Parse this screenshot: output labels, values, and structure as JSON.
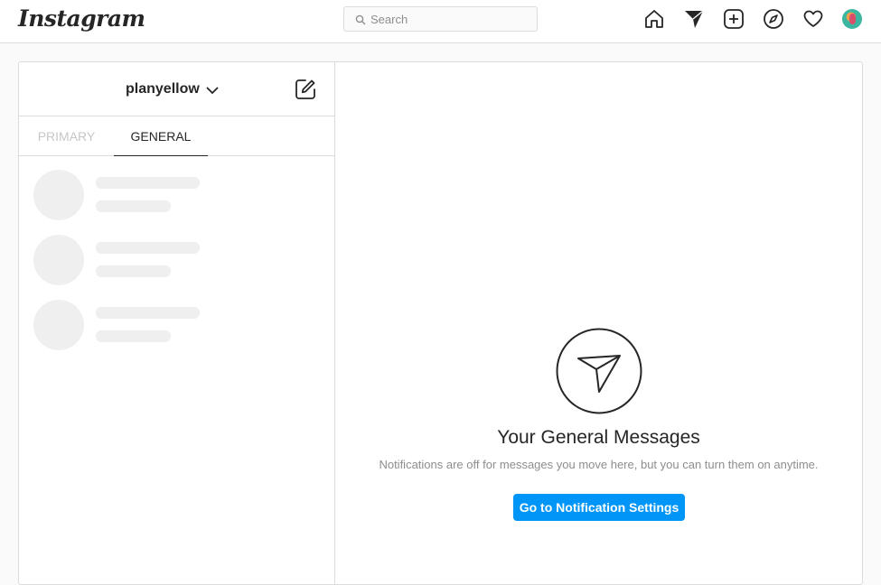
{
  "app": {
    "logo_text": "Instagram"
  },
  "search": {
    "placeholder": "Search",
    "icon": "search-icon"
  },
  "nav": {
    "icons": [
      "home-icon",
      "direct-icon",
      "new-post-icon",
      "explore-icon",
      "activity-heart-icon",
      "profile-avatar"
    ]
  },
  "inbox": {
    "username": "planyellow",
    "tabs": [
      {
        "label": "PRIMARY",
        "active": false
      },
      {
        "label": "GENERAL",
        "active": true
      }
    ],
    "skeleton_rows": 3
  },
  "empty_state": {
    "title": "Your General Messages",
    "subtitle": "Notifications are off for messages you move here, but you can turn them on anytime.",
    "button_label": "Go to Notification Settings"
  },
  "colors": {
    "accent": "#0095f6",
    "border": "#dbdbdb",
    "background": "#fafafa",
    "skeleton": "#efefef"
  }
}
